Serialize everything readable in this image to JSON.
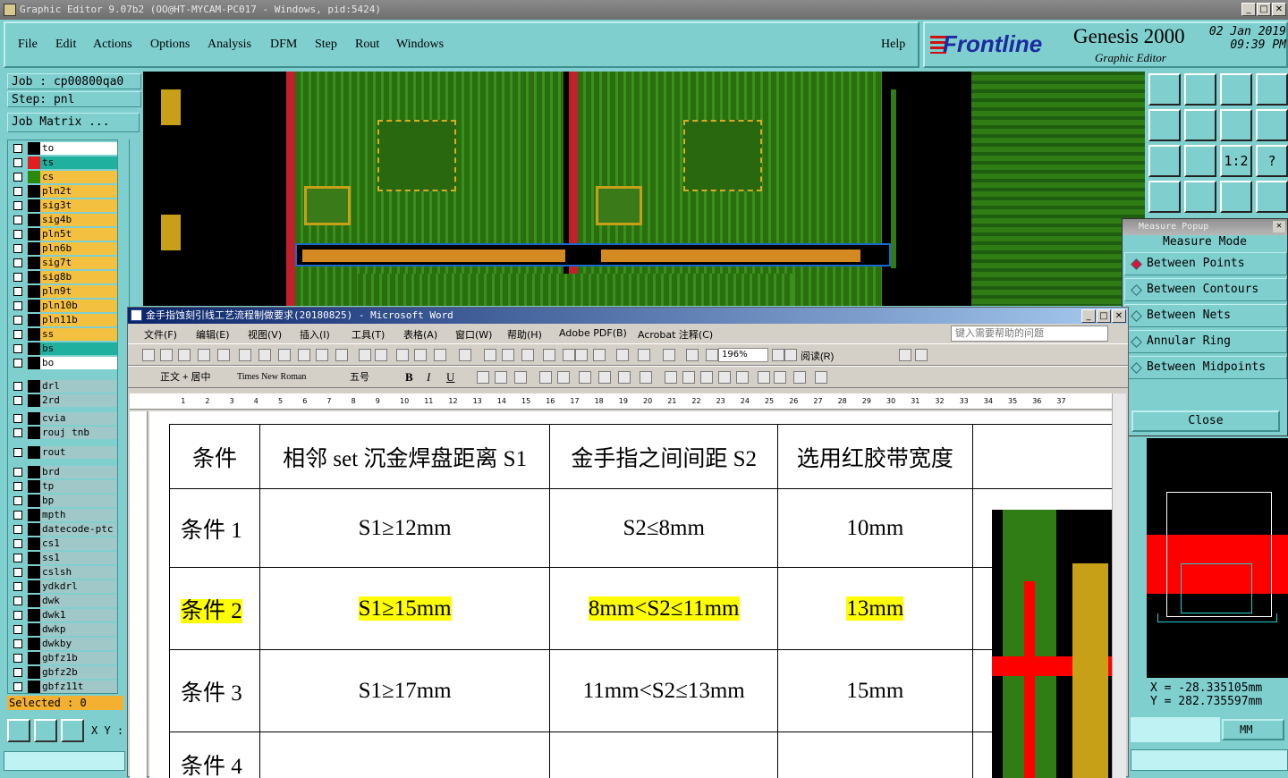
{
  "app": {
    "title": "Graphic Editor 9.07b2 (OO@HT-MYCAM-PC017 - Windows, pid:5424)"
  },
  "menu": {
    "items": [
      "File",
      "Edit",
      "Actions",
      "Options",
      "Analysis",
      "DFM",
      "Step",
      "Rout",
      "Windows"
    ],
    "help": "Help"
  },
  "brand": {
    "logo": "Frontline",
    "product": "Genesis 2000",
    "subtitle": "Graphic Editor",
    "date": "02 Jan 2019",
    "time": "09:39 PM"
  },
  "job": {
    "job": "Job : cp00800qa0",
    "step": "Step: pnl",
    "matrix_button": "Job Matrix ..."
  },
  "layers": [
    {
      "name": "to",
      "color": "#ffffff",
      "swatch": "#000000"
    },
    {
      "name": "ts",
      "color": "#20b0a0",
      "swatch": "#e02020"
    },
    {
      "name": "cs",
      "color": "#f4c040",
      "swatch": "#2a8a10"
    },
    {
      "name": "pln2t",
      "color": "#f4c040",
      "swatch": "#000000"
    },
    {
      "name": "sig3t",
      "color": "#f4c040",
      "swatch": "#000000"
    },
    {
      "name": "sig4b",
      "color": "#f4c040",
      "swatch": "#000000"
    },
    {
      "name": "pln5t",
      "color": "#f4c040",
      "swatch": "#000000"
    },
    {
      "name": "pln6b",
      "color": "#f4c040",
      "swatch": "#000000"
    },
    {
      "name": "sig7t",
      "color": "#f4c040",
      "swatch": "#000000"
    },
    {
      "name": "sig8b",
      "color": "#f4c040",
      "swatch": "#000000"
    },
    {
      "name": "pln9t",
      "color": "#f4c040",
      "swatch": "#000000"
    },
    {
      "name": "pln10b",
      "color": "#f4c040",
      "swatch": "#000000"
    },
    {
      "name": "pln11b",
      "color": "#f4c040",
      "swatch": "#000000"
    },
    {
      "name": "ss",
      "color": "#f4c040",
      "swatch": "#000000"
    },
    {
      "name": "bs",
      "color": "#20b0a0",
      "swatch": "#000000"
    },
    {
      "name": "bo",
      "color": "#ffffff",
      "swatch": "#000000"
    },
    {
      "name": "drl",
      "color": "#a0c8c8",
      "swatch": "#000000"
    },
    {
      "name": "2rd",
      "color": "#a0c8c8",
      "swatch": "#000000"
    },
    {
      "name": "cvia",
      "color": "#a0c8c8",
      "swatch": "#000000"
    },
    {
      "name": "rouj tnb",
      "color": "#a0c8c8",
      "swatch": "#000000"
    },
    {
      "name": "rout",
      "color": "#a0c8c8",
      "swatch": "#000000"
    },
    {
      "name": "brd",
      "color": "#a0c8c8",
      "swatch": "#000000"
    },
    {
      "name": "tp",
      "color": "#a0c8c8",
      "swatch": "#000000"
    },
    {
      "name": "bp",
      "color": "#a0c8c8",
      "swatch": "#000000"
    },
    {
      "name": "mpth",
      "color": "#a0c8c8",
      "swatch": "#000000"
    },
    {
      "name": "datecode-ptc",
      "color": "#a0c8c8",
      "swatch": "#000000"
    },
    {
      "name": "cs1",
      "color": "#a0c8c8",
      "swatch": "#000000"
    },
    {
      "name": "ss1",
      "color": "#a0c8c8",
      "swatch": "#000000"
    },
    {
      "name": "cslsh",
      "color": "#a0c8c8",
      "swatch": "#000000"
    },
    {
      "name": "ydkdrl",
      "color": "#a0c8c8",
      "swatch": "#000000"
    },
    {
      "name": "dwk",
      "color": "#a0c8c8",
      "swatch": "#000000"
    },
    {
      "name": "dwk1",
      "color": "#a0c8c8",
      "swatch": "#000000"
    },
    {
      "name": "dwkp",
      "color": "#a0c8c8",
      "swatch": "#000000"
    },
    {
      "name": "dwkby",
      "color": "#a0c8c8",
      "swatch": "#000000"
    },
    {
      "name": "gbfz1b",
      "color": "#a0c8c8",
      "swatch": "#000000"
    },
    {
      "name": "gbfz2b",
      "color": "#a0c8c8",
      "swatch": "#000000"
    },
    {
      "name": "gbfz11t",
      "color": "#a0c8c8",
      "swatch": "#000000"
    }
  ],
  "status": {
    "selected": "Selected : 0",
    "xy_label": "X Y :"
  },
  "right_tools": [
    "home-icon",
    "down-icon",
    "window-icon",
    "frame-icon",
    "left-icon",
    "right-icon",
    "sync-icon",
    "s-icon",
    "fit-icon",
    "center-icon",
    "1:2",
    "?",
    "tool-icon",
    "grid-icon",
    "layer-a-icon",
    "layer-b-icon"
  ],
  "measure": {
    "title": "Measure Popup",
    "mode_label": "Measure Mode",
    "options": [
      "Between Points",
      "Between Contours",
      "Between Nets",
      "Annular Ring",
      "Between Midpoints"
    ],
    "selected": 0,
    "close": "Close",
    "x": "X  = -28.335105mm",
    "y": "Y  = 282.735597mm",
    "units": "MM"
  },
  "word": {
    "title": "金手指蚀刻引线工艺流程制做要求(20180825) - Microsoft Word",
    "menu": [
      "文件(F)",
      "编辑(E)",
      "视图(V)",
      "插入(I)",
      "工具(T)",
      "表格(A)",
      "窗口(W)",
      "帮助(H)",
      "Adobe PDF(B)",
      "Acrobat 注释(C)"
    ],
    "help_placeholder": "键入需要帮助的问题",
    "zoom": "196%",
    "read_mode": "阅读(R)",
    "style": "正文 + 居中",
    "font": "Times New Roman",
    "size": "五号",
    "table": {
      "headers": [
        "条件",
        "相邻 set 沉金焊盘距离 S1",
        "金手指之间间距 S2",
        "选用红胶带宽度"
      ],
      "rows": [
        [
          "条件 1",
          "S1≥12mm",
          "S2≤8mm",
          "10mm"
        ],
        [
          "条件 2",
          "S1≥15mm",
          "8mm<S2≤11mm",
          "13mm"
        ],
        [
          "条件 3",
          "S1≥17mm",
          "11mm<S2≤13mm",
          "15mm"
        ],
        [
          "条件 4",
          "",
          "",
          ""
        ]
      ],
      "highlight_row": 1
    }
  }
}
